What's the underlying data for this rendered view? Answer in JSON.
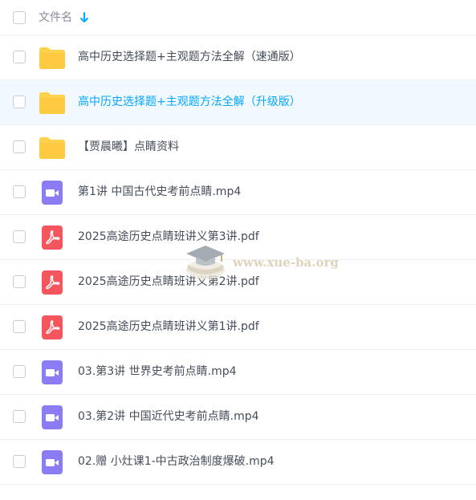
{
  "header": {
    "column_label": "文件名",
    "sort_icon": "arrow-down-icon"
  },
  "colors": {
    "accent": "#06a7ff",
    "folder": "#ffd24d",
    "video": "#8a7cf5",
    "pdf": "#f5555c",
    "hover_bg": "#f2f9fe"
  },
  "files": [
    {
      "type": "folder",
      "icon": "folder-icon",
      "name": "高中历史选择题+主观题方法全解（速通版）",
      "hover": false
    },
    {
      "type": "folder",
      "icon": "folder-icon",
      "name": "高中历史选择题+主观题方法全解（升级版）",
      "hover": true
    },
    {
      "type": "folder",
      "icon": "folder-icon",
      "name": "【贾晨曦】点睛资料",
      "hover": false
    },
    {
      "type": "video",
      "icon": "video-file-icon",
      "name": "第1讲 中国古代史考前点睛.mp4",
      "hover": false
    },
    {
      "type": "pdf",
      "icon": "pdf-file-icon",
      "name": "2025高途历史点睛班讲义第3讲.pdf",
      "hover": false
    },
    {
      "type": "pdf",
      "icon": "pdf-file-icon",
      "name": "2025高途历史点睛班讲义第2讲.pdf",
      "hover": false
    },
    {
      "type": "pdf",
      "icon": "pdf-file-icon",
      "name": "2025高途历史点睛班讲义第1讲.pdf",
      "hover": false
    },
    {
      "type": "video",
      "icon": "video-file-icon",
      "name": "03.第3讲 世界史考前点睛.mp4",
      "hover": false
    },
    {
      "type": "video",
      "icon": "video-file-icon",
      "name": "03.第2讲 中国近代史考前点睛.mp4",
      "hover": false
    },
    {
      "type": "video",
      "icon": "video-file-icon",
      "name": "02.赠 小灶课1-中古政治制度爆破.mp4",
      "hover": false
    }
  ],
  "watermark": {
    "text": "www.xue-ba.org",
    "icon": "graduation-cap-icon"
  }
}
